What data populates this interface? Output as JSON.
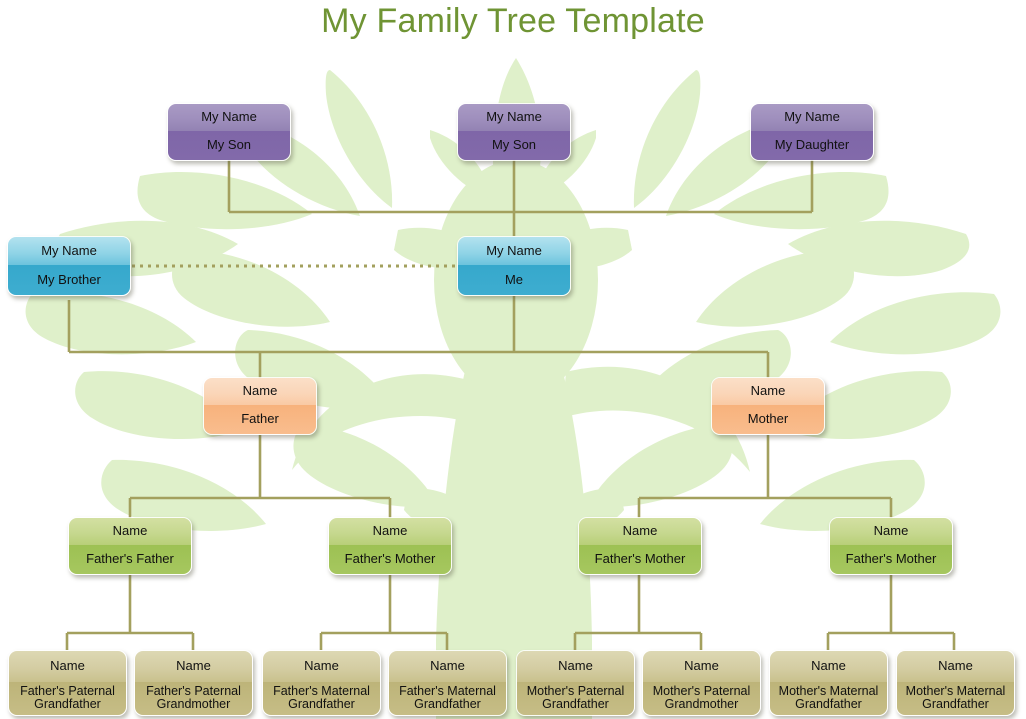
{
  "title": "My Family Tree Template",
  "colors": {
    "title": "#6f9434",
    "connector": "#a3a05e",
    "tree_leaf": "#dff0ca",
    "purple_header": "#9f8fbd",
    "purple_body": "#7f66a8",
    "blue_header": "#8ed3e6",
    "blue_body": "#36a8cc",
    "orange_header": "#fad5b7",
    "orange_body": "#f7b27c",
    "green_header": "#c6d88f",
    "green_body": "#9dc153",
    "khaki_header": "#d4cda3",
    "khaki_body": "#bdb479",
    "background": "#ffffff"
  },
  "nodes": {
    "children": [
      {
        "name_label": "My Name",
        "relation": "My Son"
      },
      {
        "name_label": "My Name",
        "relation": "My Son"
      },
      {
        "name_label": "My Name",
        "relation": "My Daughter"
      }
    ],
    "self_row": [
      {
        "name_label": "My Name",
        "relation": "My Brother"
      },
      {
        "name_label": "My Name",
        "relation": "Me"
      }
    ],
    "parents": [
      {
        "name_label": "Name",
        "relation": "Father"
      },
      {
        "name_label": "Name",
        "relation": "Mother"
      }
    ],
    "grandparents": [
      {
        "name_label": "Name",
        "relation": "Father's Father"
      },
      {
        "name_label": "Name",
        "relation": "Father's Mother"
      },
      {
        "name_label": "Name",
        "relation": "Father's Mother"
      },
      {
        "name_label": "Name",
        "relation": "Father's Mother"
      }
    ],
    "great_grandparents": [
      {
        "name_label": "Name",
        "relation_line1": "Father's Paternal",
        "relation_line2": "Grandfather"
      },
      {
        "name_label": "Name",
        "relation_line1": "Father's Paternal",
        "relation_line2": "Grandmother"
      },
      {
        "name_label": "Name",
        "relation_line1": "Father's Maternal",
        "relation_line2": "Grandfather"
      },
      {
        "name_label": "Name",
        "relation_line1": "Father's Maternal",
        "relation_line2": "Grandfather"
      },
      {
        "name_label": "Name",
        "relation_line1": "Mother's Paternal",
        "relation_line2": "Grandfather"
      },
      {
        "name_label": "Name",
        "relation_line1": "Mother's Paternal",
        "relation_line2": "Grandmother"
      },
      {
        "name_label": "Name",
        "relation_line1": "Mother's Maternal",
        "relation_line2": "Grandfather"
      },
      {
        "name_label": "Name",
        "relation_line1": "Mother's Maternal",
        "relation_line2": "Grandfather"
      }
    ]
  }
}
